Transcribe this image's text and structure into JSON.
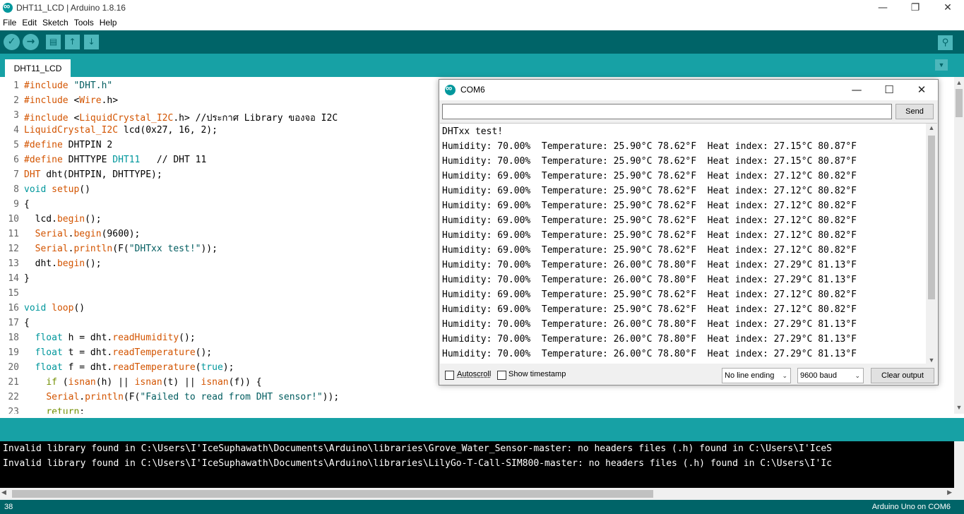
{
  "window": {
    "title": "DHT11_LCD | Arduino 1.8.16",
    "minimize": "—",
    "maximize": "❐",
    "close": "✕"
  },
  "menu": [
    "File",
    "Edit",
    "Sketch",
    "Tools",
    "Help"
  ],
  "toolbar": {
    "verify": "✓",
    "upload": "→",
    "new": "▤",
    "open": "↑",
    "save": "↓",
    "serial_monitor": "⚲"
  },
  "tab": {
    "label": "DHT11_LCD",
    "menu_arrow": "▼"
  },
  "code_lines": [
    {
      "n": "1",
      "parts": [
        [
          "k1",
          "#include "
        ],
        [
          "str",
          "\"DHT.h\""
        ]
      ]
    },
    {
      "n": "2",
      "parts": [
        [
          "k1",
          "#include "
        ],
        [
          "",
          "<"
        ],
        [
          "k1",
          "Wire"
        ],
        [
          "",
          ".h>"
        ]
      ]
    },
    {
      "n": "3",
      "parts": [
        [
          "k1",
          "#include "
        ],
        [
          "",
          "<"
        ],
        [
          "k1",
          "LiquidCrystal_I2C"
        ],
        [
          "",
          ".h> //ประกาศ Library ของจอ I2C"
        ]
      ]
    },
    {
      "n": "4",
      "parts": [
        [
          "k1",
          "LiquidCrystal_I2C"
        ],
        [
          "",
          " lcd(0x27, 16, 2);"
        ]
      ]
    },
    {
      "n": "5",
      "parts": [
        [
          "k1",
          "#define"
        ],
        [
          "",
          " DHTPIN 2"
        ]
      ]
    },
    {
      "n": "6",
      "parts": [
        [
          "k1",
          "#define"
        ],
        [
          "",
          " DHTTYPE "
        ],
        [
          "k2",
          "DHT11"
        ],
        [
          "",
          "   // DHT 11"
        ]
      ]
    },
    {
      "n": "7",
      "parts": [
        [
          "k1",
          "DHT"
        ],
        [
          "",
          " dht(DHTPIN, DHTTYPE);"
        ]
      ]
    },
    {
      "n": "8",
      "parts": [
        [
          "k2",
          "void"
        ],
        [
          "",
          " "
        ],
        [
          "k1",
          "setup"
        ],
        [
          "",
          "()"
        ]
      ]
    },
    {
      "n": "9",
      "parts": [
        [
          "",
          "{"
        ]
      ]
    },
    {
      "n": "10",
      "parts": [
        [
          "",
          "  lcd."
        ],
        [
          "k1",
          "begin"
        ],
        [
          "",
          "();"
        ]
      ]
    },
    {
      "n": "11",
      "parts": [
        [
          "",
          "  "
        ],
        [
          "k1",
          "Serial"
        ],
        [
          "",
          "."
        ],
        [
          "k1",
          "begin"
        ],
        [
          "",
          "(9600);"
        ]
      ]
    },
    {
      "n": "12",
      "parts": [
        [
          "",
          "  "
        ],
        [
          "k1",
          "Serial"
        ],
        [
          "",
          "."
        ],
        [
          "k1",
          "println"
        ],
        [
          "",
          "(F("
        ],
        [
          "str",
          "\"DHTxx test!\""
        ],
        [
          "",
          "));"
        ]
      ]
    },
    {
      "n": "13",
      "parts": [
        [
          "",
          "  dht."
        ],
        [
          "k1",
          "begin"
        ],
        [
          "",
          "();"
        ]
      ]
    },
    {
      "n": "14",
      "parts": [
        [
          "",
          "}"
        ]
      ]
    },
    {
      "n": "15",
      "parts": [
        [
          "",
          ""
        ]
      ]
    },
    {
      "n": "16",
      "parts": [
        [
          "k2",
          "void"
        ],
        [
          "",
          " "
        ],
        [
          "k1",
          "loop"
        ],
        [
          "",
          "()"
        ]
      ]
    },
    {
      "n": "17",
      "parts": [
        [
          "",
          "{"
        ]
      ]
    },
    {
      "n": "18",
      "parts": [
        [
          "",
          "  "
        ],
        [
          "k2",
          "float"
        ],
        [
          "",
          " h = dht."
        ],
        [
          "k1",
          "readHumidity"
        ],
        [
          "",
          "();"
        ]
      ]
    },
    {
      "n": "19",
      "parts": [
        [
          "",
          "  "
        ],
        [
          "k2",
          "float"
        ],
        [
          "",
          " t = dht."
        ],
        [
          "k1",
          "readTemperature"
        ],
        [
          "",
          "();"
        ]
      ]
    },
    {
      "n": "20",
      "parts": [
        [
          "",
          "  "
        ],
        [
          "k2",
          "float"
        ],
        [
          "",
          " f = dht."
        ],
        [
          "k1",
          "readTemperature"
        ],
        [
          "",
          "("
        ],
        [
          "k2",
          "true"
        ],
        [
          "",
          ");"
        ]
      ]
    },
    {
      "n": "21",
      "parts": [
        [
          "",
          "    "
        ],
        [
          "k3",
          "if"
        ],
        [
          "",
          " ("
        ],
        [
          "k1",
          "isnan"
        ],
        [
          "",
          "(h) || "
        ],
        [
          "k1",
          "isnan"
        ],
        [
          "",
          "(t) || "
        ],
        [
          "k1",
          "isnan"
        ],
        [
          "",
          "(f)) {"
        ]
      ]
    },
    {
      "n": "22",
      "parts": [
        [
          "",
          "    "
        ],
        [
          "k1",
          "Serial"
        ],
        [
          "",
          "."
        ],
        [
          "k1",
          "println"
        ],
        [
          "",
          "(F("
        ],
        [
          "str",
          "\"Failed to read from DHT sensor!\""
        ],
        [
          "",
          "));"
        ]
      ]
    },
    {
      "n": "23",
      "parts": [
        [
          "",
          "    "
        ],
        [
          "k3",
          "return"
        ],
        [
          "",
          ";"
        ]
      ]
    }
  ],
  "console": [
    "Invalid library found in C:\\Users\\I'IceSuphawath\\Documents\\Arduino\\libraries\\Grove_Water_Sensor-master: no headers files (.h) found in C:\\Users\\I'IceS",
    "Invalid library found in C:\\Users\\I'IceSuphawath\\Documents\\Arduino\\libraries\\LilyGo-T-Call-SIM800-master: no headers files (.h) found in C:\\Users\\I'Ic"
  ],
  "status": {
    "line": "38",
    "board": "Arduino Uno on COM6"
  },
  "serial": {
    "title": "COM6",
    "input_value": "",
    "send_label": "Send",
    "output": [
      "DHTxx test!",
      "Humidity: 70.00%  Temperature: 25.90°C 78.62°F  Heat index: 27.15°C 80.87°F",
      "Humidity: 70.00%  Temperature: 25.90°C 78.62°F  Heat index: 27.15°C 80.87°F",
      "Humidity: 69.00%  Temperature: 25.90°C 78.62°F  Heat index: 27.12°C 80.82°F",
      "Humidity: 69.00%  Temperature: 25.90°C 78.62°F  Heat index: 27.12°C 80.82°F",
      "Humidity: 69.00%  Temperature: 25.90°C 78.62°F  Heat index: 27.12°C 80.82°F",
      "Humidity: 69.00%  Temperature: 25.90°C 78.62°F  Heat index: 27.12°C 80.82°F",
      "Humidity: 69.00%  Temperature: 25.90°C 78.62°F  Heat index: 27.12°C 80.82°F",
      "Humidity: 69.00%  Temperature: 25.90°C 78.62°F  Heat index: 27.12°C 80.82°F",
      "Humidity: 70.00%  Temperature: 26.00°C 78.80°F  Heat index: 27.29°C 81.13°F",
      "Humidity: 70.00%  Temperature: 26.00°C 78.80°F  Heat index: 27.29°C 81.13°F",
      "Humidity: 69.00%  Temperature: 25.90°C 78.62°F  Heat index: 27.12°C 80.82°F",
      "Humidity: 69.00%  Temperature: 25.90°C 78.62°F  Heat index: 27.12°C 80.82°F",
      "Humidity: 70.00%  Temperature: 26.00°C 78.80°F  Heat index: 27.29°C 81.13°F",
      "Humidity: 70.00%  Temperature: 26.00°C 78.80°F  Heat index: 27.29°C 81.13°F",
      "Humidity: 70.00%  Temperature: 26.00°C 78.80°F  Heat index: 27.29°C 81.13°F"
    ],
    "autoscroll_label": "Autoscroll",
    "autoscroll_checked": false,
    "timestamp_label": "Show timestamp",
    "timestamp_checked": false,
    "line_ending": "No line ending",
    "baud": "9600 baud",
    "clear_label": "Clear output"
  },
  "colors": {
    "teal_dark": "#006468",
    "teal": "#17a1a5",
    "keyword_orange": "#d35400",
    "keyword_teal": "#00979c"
  }
}
